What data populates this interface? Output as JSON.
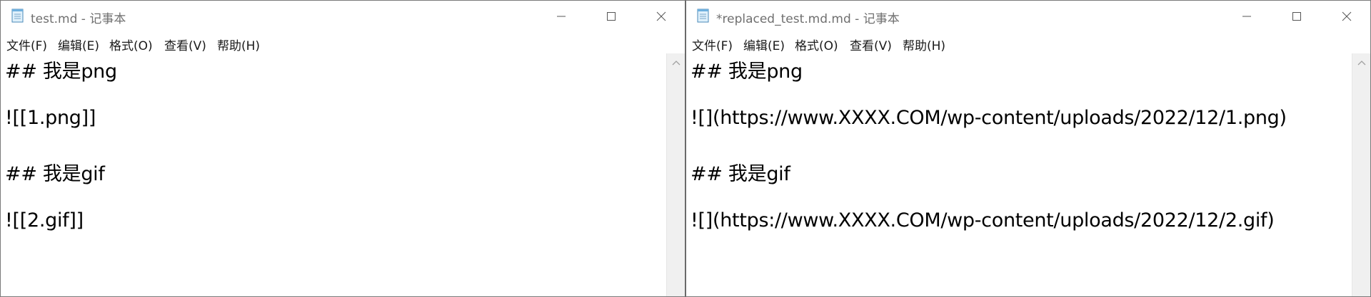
{
  "windows": [
    {
      "title": "test.md - 记事本",
      "menu": [
        "文件(F)",
        "编辑(E)",
        "格式(O)",
        "查看(V)",
        "帮助(H)"
      ],
      "lines": [
        "## 我是png",
        "![[1.png]]",
        "## 我是gif",
        "![[2.gif]]"
      ]
    },
    {
      "title": "*replaced_test.md.md - 记事本",
      "menu": [
        "文件(F)",
        "编辑(E)",
        "格式(O)",
        "查看(V)",
        "帮助(H)"
      ],
      "lines": [
        "## 我是png",
        "![](https://www.XXXX.COM/wp-content/uploads/2022/12/1.png)",
        "## 我是gif",
        "![](https://www.XXXX.COM/wp-content/uploads/2022/12/2.gif)"
      ]
    }
  ],
  "icons": {
    "app": "notepad-icon",
    "minimize": "minimize-icon",
    "maximize": "maximize-icon",
    "close": "close-icon",
    "scroll_up": "chevron-up-icon"
  }
}
